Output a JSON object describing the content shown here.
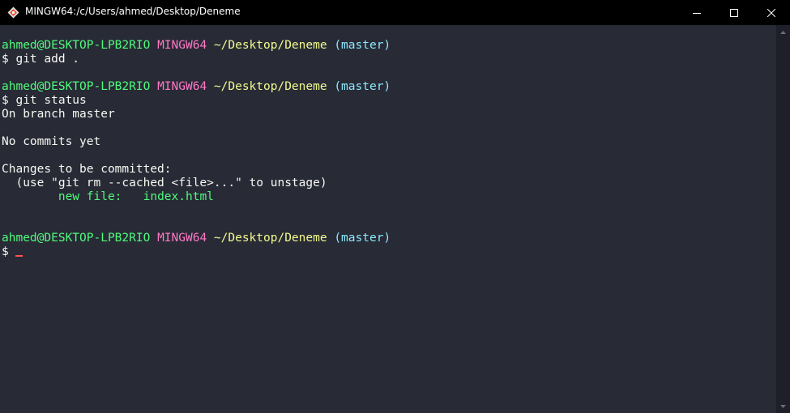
{
  "window": {
    "title": "MINGW64:/c/Users/ahmed/Desktop/Deneme",
    "icons": {
      "app": "git-bash-icon",
      "minimize": "minimize-icon",
      "maximize": "maximize-icon",
      "close": "close-icon"
    }
  },
  "colors": {
    "background": "#282a36",
    "user": "#50fa7b",
    "system": "#ff79c6",
    "path": "#f1fa8c",
    "branch": "#8be9fd",
    "cursor": "#ff5555"
  },
  "terminal": {
    "prompts": [
      {
        "user": "ahmed@DESKTOP-LPB2RIO",
        "system": "MINGW64",
        "path": "~/Desktop/Deneme",
        "branch": "(master)"
      },
      {
        "user": "ahmed@DESKTOP-LPB2RIO",
        "system": "MINGW64",
        "path": "~/Desktop/Deneme",
        "branch": "(master)"
      },
      {
        "user": "ahmed@DESKTOP-LPB2RIO",
        "system": "MINGW64",
        "path": "~/Desktop/Deneme",
        "branch": "(master)"
      }
    ],
    "commands": [
      "$ git add .",
      "$ git status",
      "$ "
    ],
    "output": {
      "branch_line": "On branch master",
      "commits_line": "No commits yet",
      "changes_header": "Changes to be committed:",
      "hint": "  (use \"git rm --cached <file>...\" to unstage)",
      "new_file_label": "        new file:   ",
      "new_file_name": "index.html"
    }
  }
}
